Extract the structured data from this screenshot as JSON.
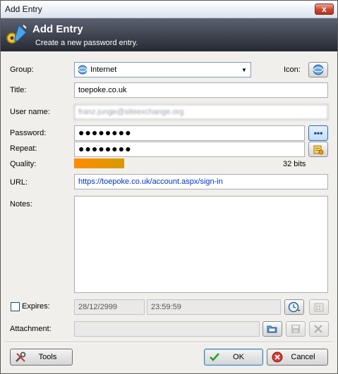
{
  "window": {
    "title": "Add Entry",
    "close_glyph": "x"
  },
  "banner": {
    "title": "Add Entry",
    "subtitle": "Create a new password entry.",
    "icon": "key-pen-icon"
  },
  "form": {
    "group_label": "Group:",
    "group_value": "Internet",
    "icon_label": "Icon:",
    "title_label": "Title:",
    "title_value": "toepoke.co.uk",
    "username_label": "User name:",
    "username_value": "franz.junge@siteexchange.org",
    "password_label": "Password:",
    "password_value": "●●●●●●●●",
    "repeat_label": "Repeat:",
    "repeat_value": "●●●●●●●●",
    "show_password_glyph": "•••",
    "quality_label": "Quality:",
    "quality_bits": "32 bits",
    "quality_fraction": 0.2,
    "url_label": "URL:",
    "url_value": "https://toepoke.co.uk/account.aspx/sign-in",
    "notes_label": "Notes:",
    "expires_label": "Expires:",
    "expires_date": "28/12/2999",
    "expires_time": "23:59:59",
    "attachment_label": "Attachment:"
  },
  "buttons": {
    "tools": "Tools",
    "ok": "OK",
    "cancel": "Cancel"
  },
  "colors": {
    "quality_bar": "#ff8c00",
    "url_text": "#0033cc",
    "banner_bg": "#3a3f4a"
  }
}
